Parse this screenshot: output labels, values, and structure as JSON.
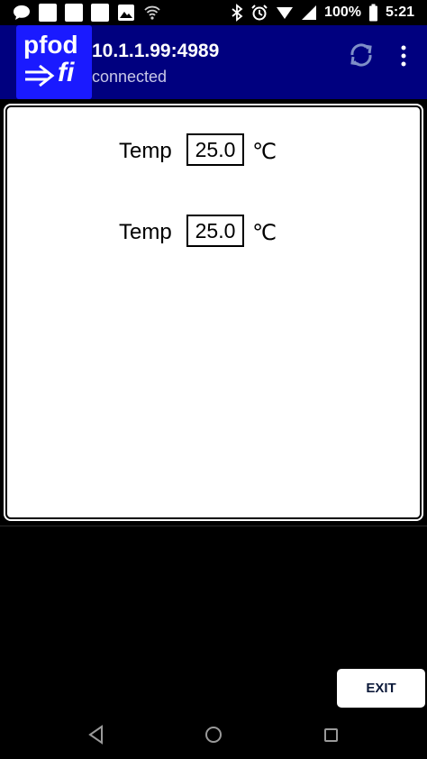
{
  "status_bar": {
    "battery": "100%",
    "time": "5:21",
    "icons": [
      "chat-icon",
      "square-icon",
      "square-icon",
      "square-icon",
      "image-icon",
      "wifi-icon",
      "bluetooth-icon",
      "alarm-icon",
      "signal-icon",
      "battery-icon"
    ]
  },
  "app_bar": {
    "logo_top": "pfod",
    "logo_bottom": "fi",
    "host": "10.1.1.99:4989",
    "connection_status": "connected"
  },
  "readings": [
    {
      "label": "Temp",
      "value": "25.0",
      "unit": "℃"
    },
    {
      "label": "Temp",
      "value": "25.0",
      "unit": "℃"
    }
  ],
  "exit_label": "EXIT",
  "colors": {
    "app_bar_bg": "#00007f",
    "logo_bg": "#1a1aff",
    "panel_bg": "#ffffff",
    "screen_bg": "#000000"
  }
}
